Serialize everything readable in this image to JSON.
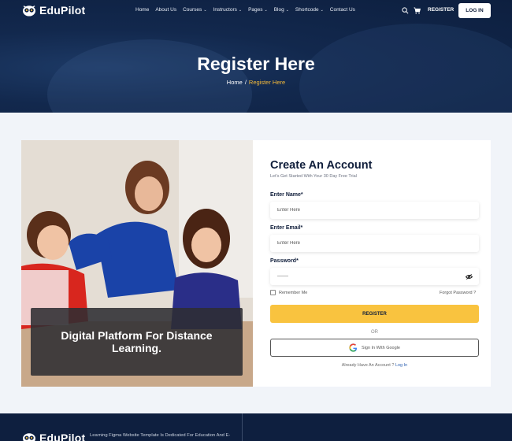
{
  "brand": {
    "name": "EduPilot"
  },
  "nav": {
    "items": [
      {
        "label": "Home",
        "caret": ""
      },
      {
        "label": "About Us",
        "caret": ""
      },
      {
        "label": "Courses",
        "caret": "⌄"
      },
      {
        "label": "Instructors",
        "caret": "⌄"
      },
      {
        "label": "Pages",
        "caret": "⌄"
      },
      {
        "label": "Blog",
        "caret": "⌄"
      },
      {
        "label": "Shortcode",
        "caret": "⌄"
      },
      {
        "label": "Contact Us",
        "caret": ""
      }
    ],
    "register_label": "REGISTER",
    "login_label": "LOG IN"
  },
  "hero": {
    "title": "Register Here",
    "breadcrumb": {
      "home": "Home",
      "separator": "/",
      "current": "Register Here"
    }
  },
  "promo": {
    "overlay_text": "Digital Platform For Distance Learning."
  },
  "form": {
    "title": "Create An Account",
    "subtitle": "Let's Get Started With Your 30 Day Free Trial",
    "name_label": "Enter Name*",
    "name_placeholder": "Enter Here",
    "email_label": "Enter Email*",
    "email_placeholder": "Enter Here",
    "password_label": "Password*",
    "password_value": "-------",
    "remember_label": "Remember Me",
    "forgot_label": "Forgot Password ?",
    "register_button": "REGISTER",
    "or_text": "OR",
    "google_button": "Sign In With Google",
    "have_account": "Already Have An Account ?",
    "login_link": "Log In"
  },
  "footer": {
    "brand": "EduPilot",
    "text": "Learning Figma Website Template Is Dedicated For Education And E-"
  },
  "colors": {
    "navy": "#0e1f3f",
    "accent": "#f9c33f",
    "crumb": "#f4b93a"
  }
}
